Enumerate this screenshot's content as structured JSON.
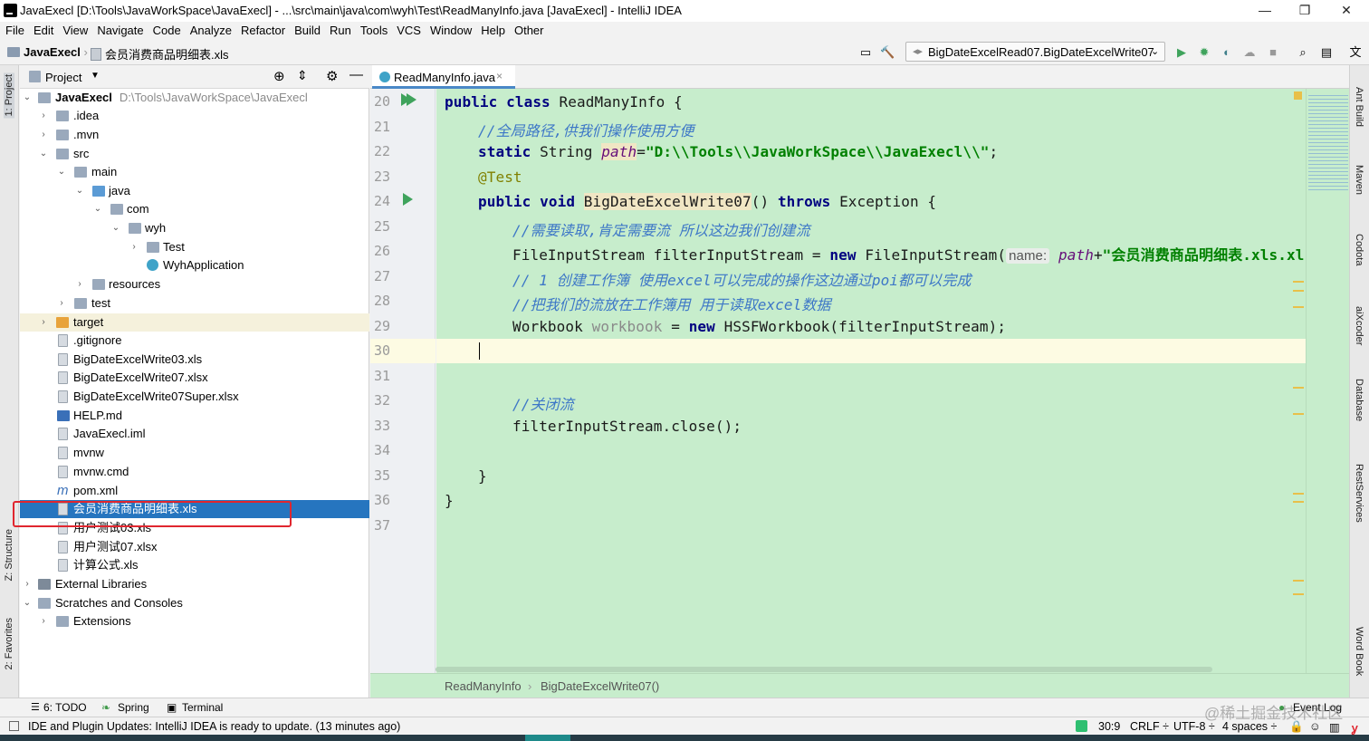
{
  "window": {
    "title": "JavaExecl [D:\\Tools\\JavaWorkSpace\\JavaExecl] - ...\\src\\main\\java\\com\\wyh\\Test\\ReadManyInfo.java [JavaExecl] - IntelliJ IDEA",
    "minimize": "—",
    "restore": "❐",
    "close": "✕"
  },
  "menu": [
    "File",
    "Edit",
    "View",
    "Navigate",
    "Code",
    "Analyze",
    "Refactor",
    "Build",
    "Run",
    "Tools",
    "VCS",
    "Window",
    "Help",
    "Other"
  ],
  "navbar": {
    "project": "JavaExecl",
    "file": "会员消费商品明细表.xls",
    "run_config": "BigDateExcelRead07.BigDateExcelWrite07"
  },
  "left_stripe": [
    "1: Project",
    "Z: Structure",
    "2: Favorites"
  ],
  "right_stripe": [
    "Ant Build",
    "Maven",
    "Codota",
    "aiXcoder",
    "Database",
    "RestServices",
    "Word Book"
  ],
  "project_panel": {
    "title": "Project",
    "root_name": "JavaExecl",
    "root_path": "D:\\Tools\\JavaWorkSpace\\JavaExecl",
    "items": [
      {
        "label": ".idea"
      },
      {
        "label": ".mvn"
      },
      {
        "label": "src"
      },
      {
        "label": "main"
      },
      {
        "label": "java"
      },
      {
        "label": "com"
      },
      {
        "label": "wyh"
      },
      {
        "label": "Test"
      },
      {
        "label": "WyhApplication"
      },
      {
        "label": "resources"
      },
      {
        "label": "test"
      },
      {
        "label": "target"
      },
      {
        "label": ".gitignore"
      },
      {
        "label": "BigDateExcelWrite03.xls"
      },
      {
        "label": "BigDateExcelWrite07.xlsx"
      },
      {
        "label": "BigDateExcelWrite07Super.xlsx"
      },
      {
        "label": "HELP.md"
      },
      {
        "label": "JavaExecl.iml"
      },
      {
        "label": "mvnw"
      },
      {
        "label": "mvnw.cmd"
      },
      {
        "label": "pom.xml"
      },
      {
        "label": "会员消费商品明细表.xls"
      },
      {
        "label": "用户测试03.xls"
      },
      {
        "label": "用户测试07.xlsx"
      },
      {
        "label": "计算公式.xls"
      },
      {
        "label": "External Libraries"
      },
      {
        "label": "Scratches and Consoles"
      },
      {
        "label": "Extensions"
      }
    ]
  },
  "editor": {
    "tab": "ReadManyInfo.java",
    "line_numbers": [
      "20",
      "21",
      "22",
      "23",
      "24",
      "25",
      "26",
      "27",
      "28",
      "29",
      "30",
      "31",
      "32",
      "33",
      "34",
      "35",
      "36",
      "37"
    ],
    "code": {
      "l20_a": "public class ",
      "l20_b": "ReadManyInfo {",
      "l21": "//全局路径,供我们操作使用方便",
      "l22_a": "static ",
      "l22_b": "String ",
      "l22_c": "path",
      "l22_d": "=",
      "l22_e": "\"D:\\\\Tools\\\\JavaWorkSpace\\\\JavaExecl\\\\\"",
      "l22_f": ";",
      "l23": "@Test",
      "l24_a": "public void ",
      "l24_b": "BigDateExcelWrite07",
      "l24_c": "() ",
      "l24_d": "throws ",
      "l24_e": "Exception {",
      "l25": "//需要读取,肯定需要流 所以这边我们创建流",
      "l26_a": "FileInputStream filterInputStream = ",
      "l26_b": "new ",
      "l26_c": "FileInputStream(",
      "l26_d": "name:",
      "l26_e": "path",
      "l26_f": "+",
      "l26_g": "\"会员消费商品明细表.xls.xl",
      "l27": "// 1 创建工作簿 使用excel可以完成的操作这边通过poi都可以完成",
      "l28": "//把我们的流放在工作簿用 用于读取excel数据",
      "l29_a": "Workbook ",
      "l29_b": "workbook",
      "l29_c": " = ",
      "l29_d": "new ",
      "l29_e": "HSSFWorkbook(filterInputStream);",
      "l32": "//关闭流",
      "l33": "filterInputStream.close();",
      "l35": "}",
      "l36": "}"
    },
    "breadcrumb": [
      "ReadManyInfo",
      "BigDateExcelWrite07()"
    ]
  },
  "bottom_tabs": [
    "6: TODO",
    "Spring",
    "Terminal",
    "Event Log"
  ],
  "status": {
    "message": "IDE and Plugin Updates: IntelliJ IDEA is ready to update. (13 minutes ago)",
    "position": "30:9",
    "line_sep": "CRLF ÷",
    "encoding": "UTF-8 ÷",
    "indent": "4 spaces ÷",
    "watermark": "@稀土掘金技术社区"
  },
  "colors": {
    "editor_bg": "#c7edcc",
    "selection": "#2675bf",
    "highlight_box": "#e0262f",
    "keyword": "#000080",
    "comment": "#3d77c7",
    "string": "#008000"
  }
}
